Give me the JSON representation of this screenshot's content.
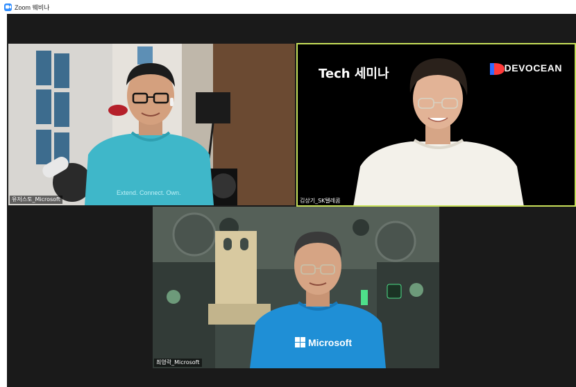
{
  "window": {
    "title": "Zoom 웨비나",
    "logo_icon": "zoom-camera-icon"
  },
  "participants": [
    {
      "name": "유저스토_Microsoft",
      "shirt_text": "Extend. Connect. Own."
    },
    {
      "name": "김상기_SK텔레콤",
      "active_speaker": true,
      "banner_title": "Tech 세미나",
      "banner_brand": "DEVOCEAN"
    },
    {
      "name": "최영락_Microsoft",
      "shirt_text": "Microsoft"
    }
  ],
  "colors": {
    "zoom_blue": "#2d8cff",
    "active_speaker_border": "#c8e15a",
    "stage_background": "#1a1a1a",
    "teal_shirt": "#3fb7c9",
    "blue_shirt": "#1f8fd6",
    "devocean_accent": "#2f6bff"
  }
}
